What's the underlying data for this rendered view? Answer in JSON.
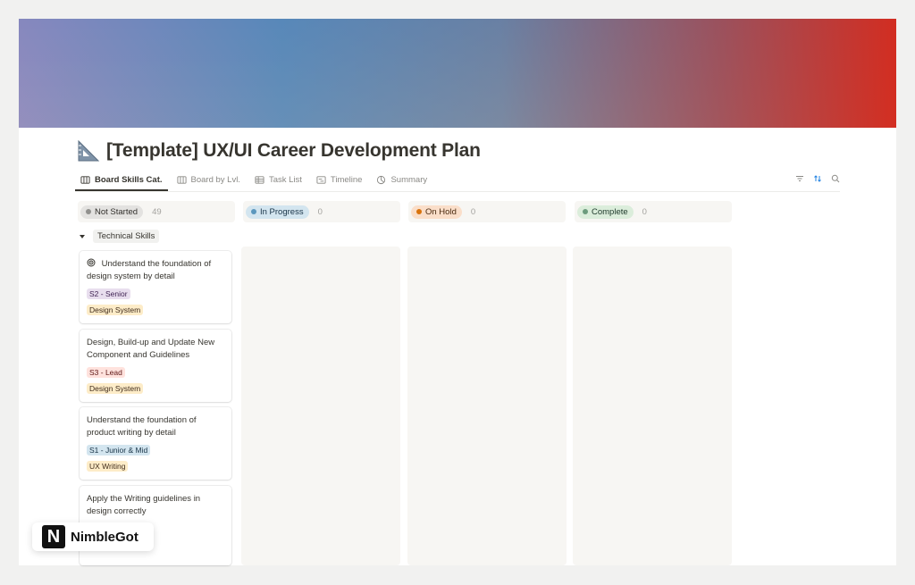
{
  "page": {
    "title": "[Template] UX/UI Career Development Plan"
  },
  "tabs": [
    {
      "label": "Board Skills Cat.",
      "icon": "board-icon",
      "active": true
    },
    {
      "label": "Board by Lvl.",
      "icon": "board-icon",
      "active": false
    },
    {
      "label": "Task List",
      "icon": "table-icon",
      "active": false
    },
    {
      "label": "Timeline",
      "icon": "timeline-icon",
      "active": false
    },
    {
      "label": "Summary",
      "icon": "chart-pie-icon",
      "active": false
    }
  ],
  "toolbar": {
    "icons": [
      "filter-icon",
      "sort-icon",
      "search-icon"
    ]
  },
  "columns": [
    {
      "label": "Not Started",
      "count": "49",
      "bg": "#e3e2e0",
      "dot": "#91918e",
      "text": "#32302c"
    },
    {
      "label": "In Progress",
      "count": "0",
      "bg": "#d3e5ef",
      "dot": "#5b97bd",
      "text": "#183347"
    },
    {
      "label": "On Hold",
      "count": "0",
      "bg": "#fadec9",
      "dot": "#d9730d",
      "text": "#49290e"
    },
    {
      "label": "Complete",
      "count": "0",
      "bg": "#dbeddb",
      "dot": "#6c9b7d",
      "text": "#1c3829"
    }
  ],
  "group": {
    "label": "Technical Skills"
  },
  "cards": [
    {
      "title": "Understand the foundation of design system by detail",
      "level": "S2 - Senior",
      "level_bg": "#e8deee",
      "level_fg": "#412454",
      "category": "Design System",
      "category_bg": "#fdecc8",
      "category_fg": "#402c1b",
      "has_icon": true
    },
    {
      "title": "Design, Build-up and Update New Component and Guidelines",
      "level": "S3 - Lead",
      "level_bg": "#ffe2dd",
      "level_fg": "#5d1715",
      "category": "Design System",
      "category_bg": "#fdecc8",
      "category_fg": "#402c1b",
      "has_icon": false
    },
    {
      "title": "Understand the foundation of product writing by detail",
      "level": "S1 - Junior & Mid",
      "level_bg": "#d3e5ef",
      "level_fg": "#183347",
      "category": "UX Writing",
      "category_bg": "#fdecc8",
      "category_fg": "#402c1b",
      "has_icon": false
    },
    {
      "title": "Apply the Writing guidelines in design correctly",
      "level": "",
      "category": "",
      "has_icon": false
    }
  ],
  "brand": {
    "letter": "N",
    "name": "NimbleGot"
  }
}
